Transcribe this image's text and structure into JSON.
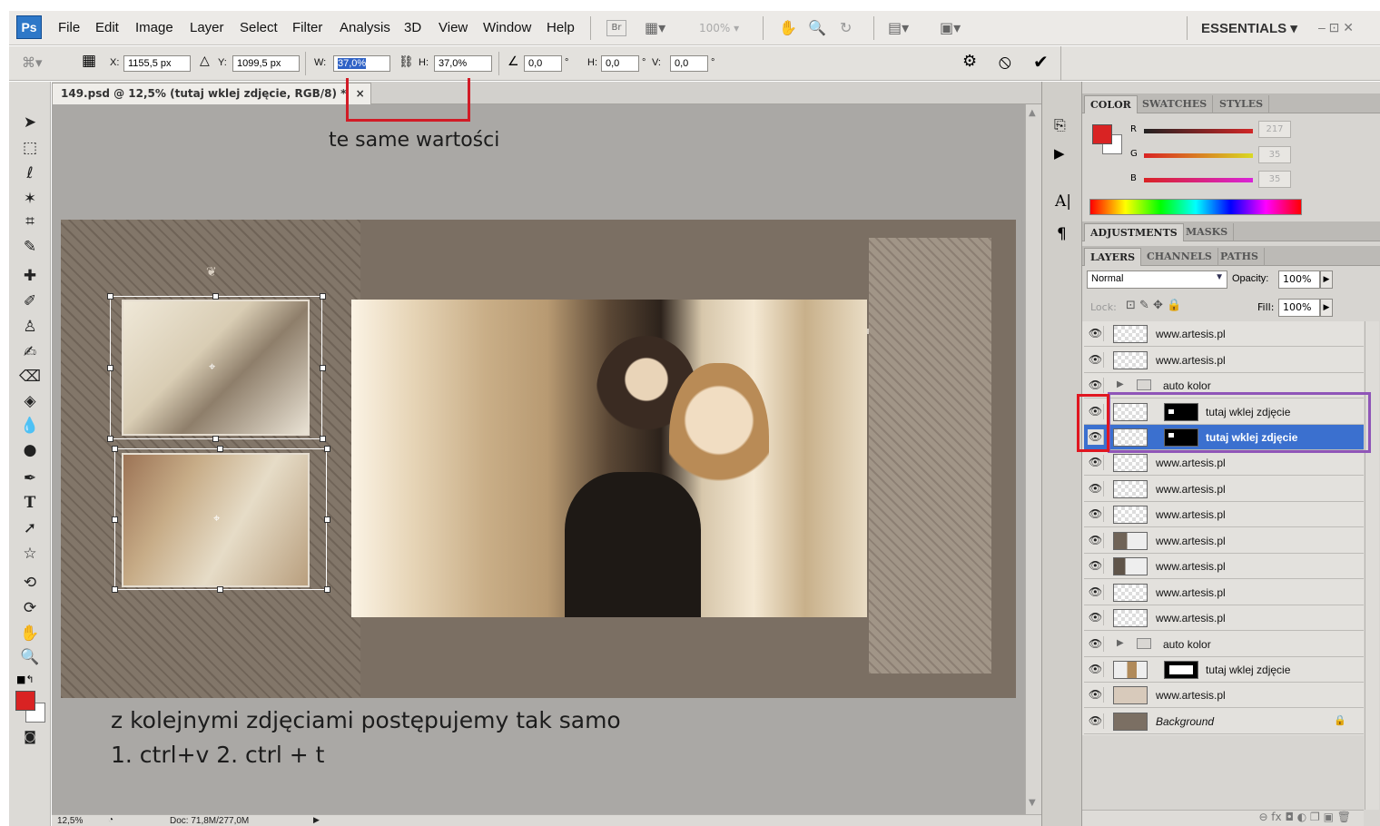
{
  "app": {
    "logo": "Ps",
    "workspace": "ESSENTIALS ▾",
    "window_controls": "– ⊡ ✕"
  },
  "menu": [
    "File",
    "Edit",
    "Image",
    "Layer",
    "Select",
    "Filter",
    "Analysis",
    "3D",
    "View",
    "Window",
    "Help"
  ],
  "toolbar": {
    "br_label": "Br",
    "zoom": "100% ▾"
  },
  "options": {
    "x_label": "X:",
    "x_value": "1155,5 px",
    "y_label": "Y:",
    "y_value": "1099,5 px",
    "w_label": "W:",
    "w_value": "37,0%",
    "h_label": "H:",
    "h_value": "37,0%",
    "angle_value": "0,0",
    "deg1": "°",
    "hskew_label": "H:",
    "hskew_value": "0,0",
    "deg2": "°",
    "vskew_label": "V:",
    "vskew_value": "0,0",
    "deg3": "°",
    "cancel_symbol": "⦸",
    "commit_symbol": "✔"
  },
  "document": {
    "tab_title": "149.psd @ 12,5% (tutaj wklej zdjęcie, RGB/8) *",
    "close": "×"
  },
  "status": {
    "zoom": "12,5%",
    "doc": "Doc: 71,8M/277,0M"
  },
  "annotations": {
    "same_values": "te same wartości",
    "next_photos": "z kolejnymi zdjęciami postępujemy tak samo",
    "keys": "1. ctrl+v    2. ctrl + t"
  },
  "color_panel": {
    "tabs": [
      "COLOR",
      "SWATCHES",
      "STYLES"
    ],
    "r_label": "R",
    "g_label": "G",
    "b_label": "B",
    "r_value": "217",
    "g_value": "35",
    "b_value": "35",
    "foreground": "#d92323"
  },
  "adjustments_panel": {
    "tabs": [
      "ADJUSTMENTS",
      "MASKS"
    ]
  },
  "layers_panel": {
    "tabs": [
      "LAYERS",
      "CHANNELS",
      "PATHS"
    ],
    "blend_mode": "Normal",
    "opacity_label": "Opacity:",
    "opacity_value": "100%",
    "lock_label": "Lock:",
    "fill_label": "Fill:",
    "fill_value": "100%",
    "layers": [
      {
        "name": "www.artesis.pl"
      },
      {
        "name": "www.artesis.pl"
      },
      {
        "name": "auto kolor"
      },
      {
        "name": "tutaj wklej zdjęcie"
      },
      {
        "name": "tutaj wklej zdjęcie"
      },
      {
        "name": "www.artesis.pl"
      },
      {
        "name": "www.artesis.pl"
      },
      {
        "name": "www.artesis.pl"
      },
      {
        "name": "www.artesis.pl"
      },
      {
        "name": "www.artesis.pl"
      },
      {
        "name": "www.artesis.pl"
      },
      {
        "name": "www.artesis.pl"
      },
      {
        "name": "auto kolor"
      },
      {
        "name": "tutaj wklej zdjęcie"
      },
      {
        "name": "www.artesis.pl"
      },
      {
        "name": "Background"
      }
    ],
    "footer_icons": "⊖ fx ◘ ◐ ❐ ▣ 🗑"
  }
}
